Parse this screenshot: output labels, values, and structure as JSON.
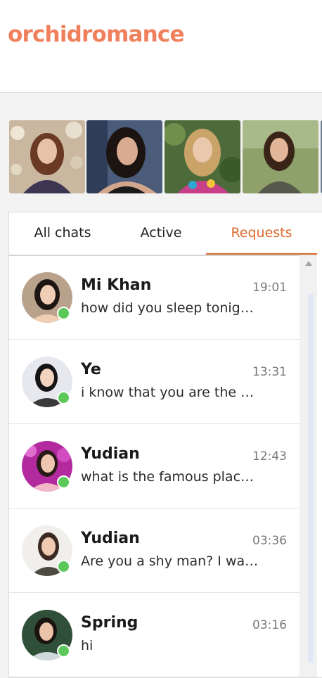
{
  "brand": {
    "logo": "orchidromance",
    "logo_color": "#f07f5c"
  },
  "featured_photos": [
    {
      "name": "featured-photo-1"
    },
    {
      "name": "featured-photo-2"
    },
    {
      "name": "featured-photo-3"
    },
    {
      "name": "featured-photo-4"
    }
  ],
  "tabs": [
    {
      "label": "All chats",
      "active": false
    },
    {
      "label": "Active",
      "active": false
    },
    {
      "label": "Requests",
      "active": true
    }
  ],
  "accent_color": "#e06a2c",
  "online_color": "#5cc85a",
  "chats": [
    {
      "name": "Mi Khan",
      "time": "19:01",
      "message": "how did you sleep tonight?",
      "online": true
    },
    {
      "name": "Ye",
      "time": "13:31",
      "message": "i know that you are the same",
      "online": true
    },
    {
      "name": "Yudian",
      "time": "12:43",
      "message": "what is the famous place in your city",
      "online": true
    },
    {
      "name": "Yudian",
      "time": "03:36",
      "message": "Are you a shy man? I want to know",
      "online": true
    },
    {
      "name": "Spring",
      "time": "03:16",
      "message": "hi",
      "online": true
    }
  ]
}
